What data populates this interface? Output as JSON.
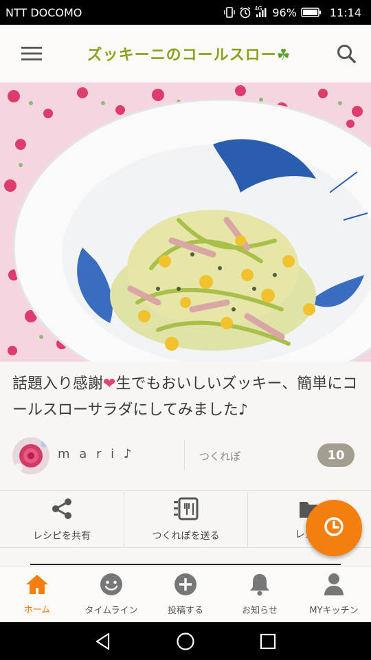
{
  "status_bar": {
    "carrier": "NTT DOCOMO",
    "battery": "96%",
    "time": "11:14",
    "network": "4G",
    "icons": [
      "vibrate-icon",
      "alarm-icon",
      "signal-icon",
      "battery-icon"
    ]
  },
  "appbar": {
    "title": "ズッキーニのコールスロー",
    "title_emoji": "☘",
    "menu_icon": "hamburger-menu-icon",
    "search_icon": "search-icon",
    "accent": "#8aa21c"
  },
  "description": {
    "prefix": "話題入り感謝",
    "heart": "❤",
    "text": "生でもおいしいズッキー、簡単にコールスローサラダにしてみました♪"
  },
  "author": {
    "name": "m a r i ♪",
    "tsukurepo_label": "つくれぽ",
    "tsukurepo_count": "10"
  },
  "actions": [
    {
      "label": "レシピを共有",
      "icon": "share-icon"
    },
    {
      "label": "つくれぽを送る",
      "icon": "send-report-icon"
    },
    {
      "label": "レシピ",
      "icon": "folder-icon"
    }
  ],
  "fab": {
    "icon": "clock-icon",
    "color": "#f47e0e"
  },
  "bottom_nav": [
    {
      "label": "ホーム",
      "icon": "home-icon",
      "active": true
    },
    {
      "label": "タイムライン",
      "icon": "smiley-icon",
      "active": false
    },
    {
      "label": "投稿する",
      "icon": "plus-circle-icon",
      "active": false
    },
    {
      "label": "お知らせ",
      "icon": "bell-icon",
      "active": false
    },
    {
      "label": "MYキッチン",
      "icon": "person-icon",
      "active": false
    }
  ],
  "colors": {
    "accent_orange": "#f47e0e",
    "badge": "#a39e91",
    "heart": "#e0457b"
  }
}
